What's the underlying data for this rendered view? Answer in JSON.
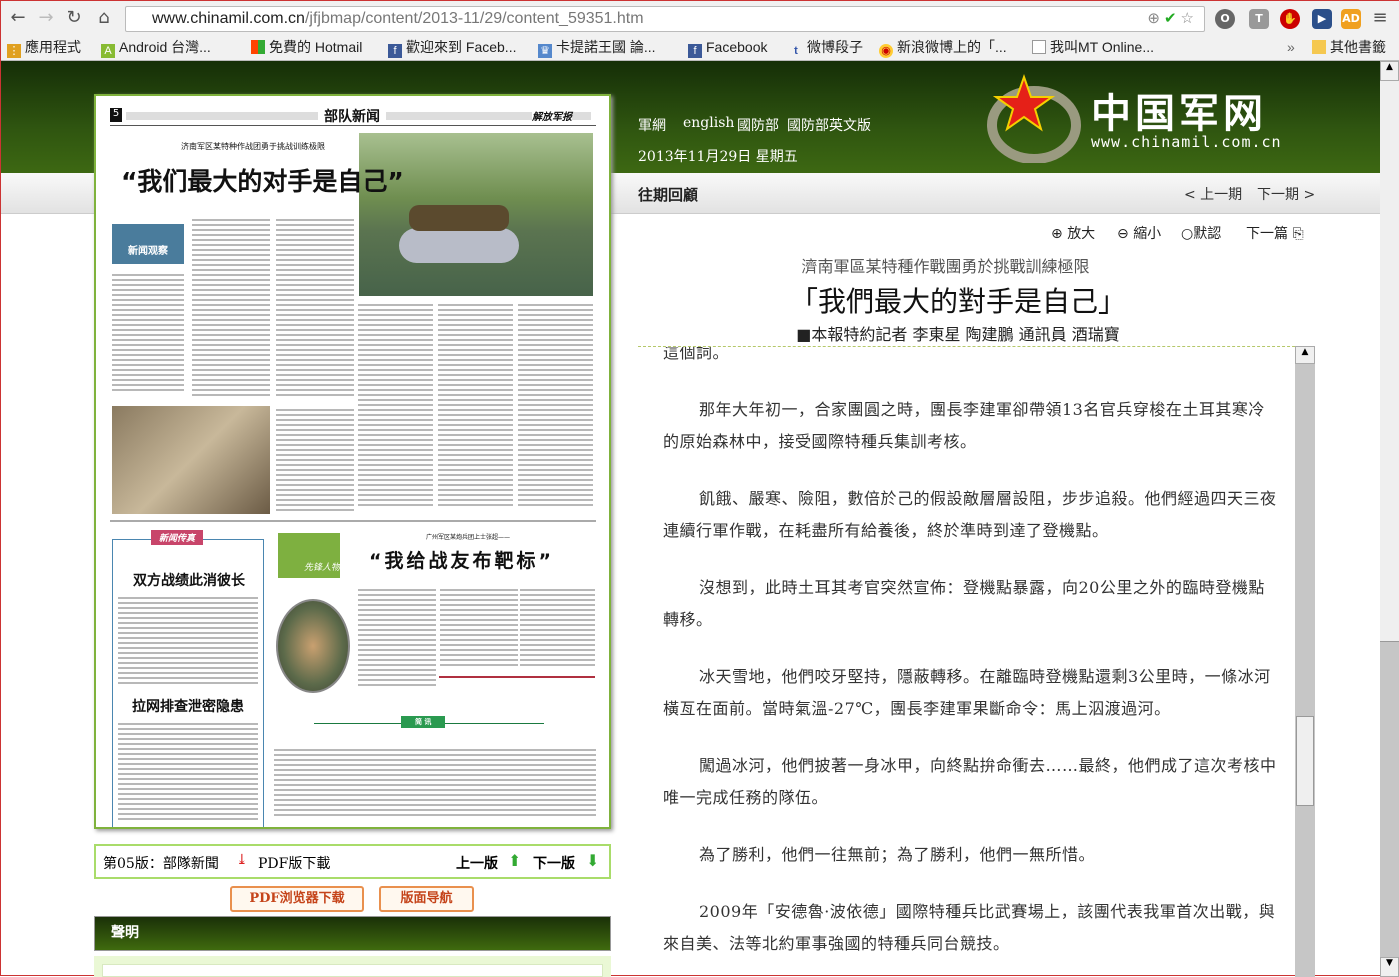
{
  "browser": {
    "url_host": "www.chinamil.com.cn",
    "url_path": "/jfjbmap/content/2013-11/29/content_59351.htm",
    "bookmarks": [
      "應用程式",
      "Android 台灣...",
      "免費的 Hotmail",
      "歡迎來到 Faceb...",
      "卡提諾王國 論...",
      "Facebook",
      "微博段子",
      "新浪微博上的「...",
      "我叫MT Online...",
      "»",
      "其他書籤"
    ]
  },
  "header": {
    "links": [
      "軍網",
      "english",
      "國防部",
      "國防部英文版"
    ],
    "date": "2013年11月29日 星期五",
    "logo_text": "中国军网",
    "logo_url": "www.chinamil.com.cn",
    "archive": "往期回顧",
    "prev_issue": "< 上一期",
    "next_issue": "下一期 >"
  },
  "newspaper": {
    "page_no": "5",
    "section": "部队新闻",
    "masthead": "解放军报",
    "kicker1": "济南军区某特种作战团勇于挑战训练极限",
    "headline1": "“我们最大的对手是自己”",
    "badge1": "新闻观察",
    "badge2": "新闻传真",
    "badge3": "先锋人物",
    "kicker2": "广州军区某炮兵团上士张超——",
    "headline2": "“我给战友布靶标”",
    "headline3": "双方战绩此消彼长",
    "headline4": "拉网排查泄密隐患",
    "brief": "简 讯"
  },
  "edition_bar": {
    "edition": "第05版：部隊新聞",
    "pdf": "PDF版下載",
    "prev": "上一版",
    "next": "下一版"
  },
  "buttons": {
    "pdf_reader": "PDF浏览器下载",
    "layout_nav": "版面导航"
  },
  "declaration": "聲明",
  "tools": {
    "zoom_in": "放大",
    "zoom_out": "縮小",
    "default": "默認",
    "next_article": "下一篇"
  },
  "article": {
    "subtitle": "濟南軍區某特種作戰團勇於挑戰訓練極限",
    "title": "「我們最大的對手是自己」",
    "byline": "■本報特約記者 李東星 陶建鵬 通訊員 酒瑞寶",
    "paragraphs": [
      "這個詞。",
      "那年大年初一，合家團圓之時，團長李建軍卻帶領13名官兵穿梭在土耳其寒冷的原始森林中，接受國際特種兵集訓考核。",
      "飢餓、嚴寒、險阻，數倍於己的假設敵層層設阻，步步追殺。他們經過四天三夜連續行軍作戰，在耗盡所有給養後，終於準時到達了登機點。",
      "沒想到，此時土耳其考官突然宣佈：登機點暴露，向20公里之外的臨時登機點轉移。",
      "冰天雪地，他們咬牙堅持，隱蔽轉移。在離臨時登機點還剩3公里時，一條冰河橫亙在面前。當時氣溫-27℃，團長李建軍果斷命令：馬上泅渡過河。",
      "闖過冰河，他們披著一身冰甲，向終點拚命衝去……最終，他們成了這次考核中唯一完成任務的隊伍。",
      "為了勝利，他們一往無前；為了勝利，他們一無所惜。",
      "2009年「安德魯·波依德」國際特種兵比武賽場上，該團代表我軍首次出戰，與來自美、法等北約軍事強國的特種兵同台競技。"
    ]
  }
}
